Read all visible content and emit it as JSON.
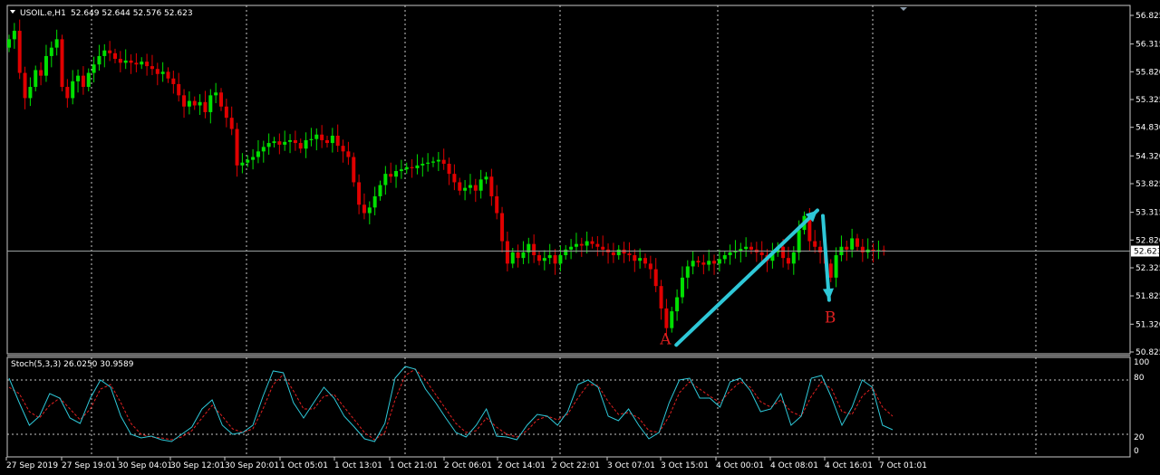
{
  "header": {
    "symbol": "USOIL.e,H1",
    "ohlc": "52.649 52.644 52.576 52.623"
  },
  "colors": {
    "background": "#000000",
    "bull": "#00e000",
    "bear": "#e00000",
    "grid": "#c8c8c8",
    "price_line": "#9aa0a0",
    "arrow": "#2ec8d8",
    "stoch_main": "#2ec8d8",
    "stoch_signal": "#e02020",
    "annotation": "#e02020"
  },
  "chart_data": {
    "type": "candlestick",
    "price_ticks": [
      "56.825",
      "56.315",
      "55.820",
      "55.325",
      "54.830",
      "54.320",
      "53.825",
      "53.315",
      "52.820",
      "52.325",
      "51.825",
      "51.320",
      "50.825"
    ],
    "ylim": [
      50.825,
      56.825
    ],
    "current_price": "52.623",
    "time_labels": [
      "27 Sep 2019",
      "27 Sep 19:01",
      "30 Sep 04:01",
      "30 Sep 12:01",
      "30 Sep 20:01",
      "1 Oct 05:01",
      "1 Oct 13:01",
      "1 Oct 21:01",
      "2 Oct 06:01",
      "2 Oct 14:01",
      "2 Oct 22:01",
      "3 Oct 07:01",
      "3 Oct 15:01",
      "4 Oct 00:01",
      "4 Oct 08:01",
      "4 Oct 16:01",
      "7 Oct 01:01"
    ],
    "closes": [
      56.4,
      56.55,
      55.8,
      55.35,
      55.55,
      55.85,
      55.75,
      56.1,
      56.25,
      56.4,
      55.55,
      55.35,
      55.65,
      55.75,
      55.55,
      55.8,
      55.95,
      56.1,
      56.2,
      56.15,
      56.05,
      55.98,
      56.02,
      55.98,
      55.95,
      56.0,
      55.92,
      55.87,
      55.78,
      55.82,
      55.7,
      55.6,
      55.4,
      55.2,
      55.3,
      55.22,
      55.28,
      55.1,
      55.4,
      55.45,
      55.2,
      55.0,
      54.8,
      54.15,
      54.2,
      54.25,
      54.3,
      54.4,
      54.48,
      54.55,
      54.58,
      54.52,
      54.57,
      54.6,
      54.55,
      54.45,
      54.6,
      54.62,
      54.7,
      54.6,
      54.55,
      54.68,
      54.5,
      54.4,
      54.3,
      53.85,
      53.45,
      53.3,
      53.4,
      53.6,
      53.8,
      54.0,
      53.95,
      54.05,
      54.08,
      54.12,
      54.1,
      54.15,
      54.18,
      54.2,
      54.22,
      54.25,
      54.18,
      54.0,
      53.85,
      53.7,
      53.75,
      53.8,
      53.7,
      53.9,
      53.95,
      53.6,
      53.3,
      52.8,
      52.4,
      52.6,
      52.5,
      52.6,
      52.75,
      52.55,
      52.45,
      52.5,
      52.55,
      52.4,
      52.55,
      52.65,
      52.7,
      52.75,
      52.72,
      52.8,
      52.75,
      52.7,
      52.65,
      52.6,
      52.55,
      52.65,
      52.58,
      52.55,
      52.45,
      52.5,
      52.4,
      52.3,
      52.0,
      51.6,
      51.25,
      51.55,
      51.8,
      52.15,
      52.35,
      52.45,
      52.42,
      52.38,
      52.45,
      52.4,
      52.48,
      52.55,
      52.6,
      52.62,
      52.66,
      52.7,
      52.65,
      52.6,
      52.55,
      52.45,
      52.6,
      52.7,
      52.5,
      52.4,
      52.6,
      53.0,
      53.25,
      52.8,
      52.7,
      52.6,
      52.4,
      52.15,
      52.55,
      52.7,
      52.65,
      52.85,
      52.7,
      52.6,
      52.65,
      52.62,
      52.64,
      52.623
    ],
    "annotations": [
      {
        "label": "A",
        "price": 50.95,
        "bar": 125
      },
      {
        "label": "B",
        "price": 51.75,
        "bar": 154
      }
    ],
    "stochastic": {
      "label": "Stoch(5,3,3) 26.0250 30.9589",
      "levels": [
        "100",
        "80",
        "20",
        "0"
      ],
      "ylim": [
        0,
        100
      ],
      "main": [
        82,
        55,
        30,
        40,
        65,
        60,
        38,
        32,
        60,
        80,
        72,
        40,
        20,
        16,
        18,
        14,
        12,
        20,
        28,
        48,
        58,
        30,
        20,
        22,
        30,
        62,
        90,
        88,
        55,
        38,
        55,
        72,
        60,
        40,
        28,
        15,
        12,
        32,
        82,
        95,
        92,
        70,
        55,
        38,
        22,
        17,
        30,
        48,
        18,
        17,
        14,
        30,
        42,
        40,
        30,
        45,
        75,
        80,
        72,
        40,
        35,
        48,
        30,
        15,
        22,
        55,
        80,
        82,
        60,
        60,
        50,
        78,
        82,
        68,
        45,
        48,
        65,
        30,
        40,
        82,
        85,
        60,
        30,
        50,
        80,
        72,
        30,
        25
      ],
      "signal": [
        72,
        65,
        45,
        38,
        52,
        60,
        48,
        36,
        48,
        70,
        75,
        55,
        32,
        20,
        17,
        16,
        14,
        17,
        24,
        38,
        52,
        40,
        26,
        22,
        26,
        48,
        75,
        86,
        68,
        48,
        48,
        62,
        64,
        50,
        36,
        22,
        14,
        22,
        58,
        85,
        92,
        80,
        64,
        48,
        32,
        22,
        24,
        38,
        28,
        20,
        17,
        24,
        36,
        40,
        36,
        42,
        60,
        75,
        74,
        56,
        42,
        44,
        38,
        24,
        22,
        40,
        66,
        78,
        70,
        62,
        55,
        68,
        78,
        72,
        56,
        50,
        58,
        45,
        40,
        62,
        78,
        70,
        45,
        42,
        62,
        72,
        50,
        40
      ]
    }
  }
}
